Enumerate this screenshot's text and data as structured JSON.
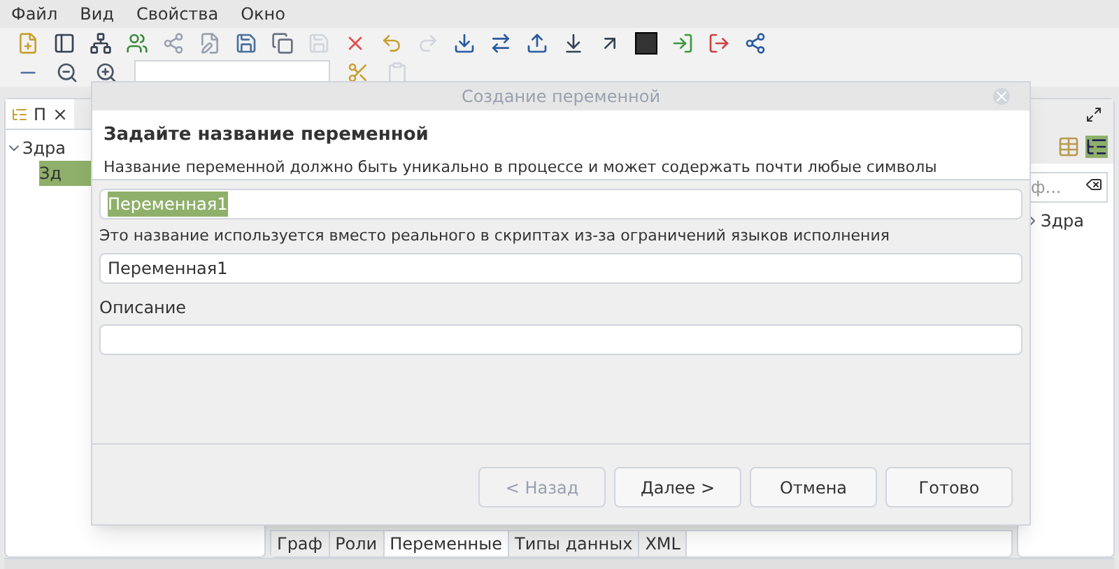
{
  "menu": [
    "Файл",
    "Вид",
    "Свойства",
    "Окно"
  ],
  "left_panel": {
    "tab": "П",
    "tree": [
      {
        "label": "Здра",
        "expanded": true,
        "selected": false,
        "children": [
          {
            "label": "Зд",
            "selected": true
          }
        ]
      }
    ]
  },
  "right_panel": {
    "search": {
      "placeholder": "ф..."
    },
    "tree": [
      {
        "label": "Здра",
        "expanded": false,
        "selected": false
      }
    ]
  },
  "editor_tabs": [
    {
      "label": "Граф",
      "selected": false
    },
    {
      "label": "Роли",
      "selected": false
    },
    {
      "label": "Переменные",
      "selected": true
    },
    {
      "label": "Типы данных",
      "selected": false
    },
    {
      "label": "XML",
      "selected": false
    }
  ],
  "dialog": {
    "window_title": "Создание переменной",
    "heading": "Задайте название переменной",
    "description": "Название переменной должно быть уникально в процессе и может содержать почти любые символы",
    "name_field": {
      "value": "Переменная1",
      "text_selected": true
    },
    "script_name_label": "Это название используется вместо реального в скриптах из-за ограничений языков исполнения",
    "script_name_field": {
      "value": "Переменная1"
    },
    "description_label": "Описание",
    "buttons": [
      {
        "label": "< Назад",
        "disabled": true
      },
      {
        "label": "Далее >",
        "disabled": false
      },
      {
        "label": "Отмена",
        "disabled": false
      },
      {
        "label": "Готово",
        "disabled": false
      }
    ]
  }
}
